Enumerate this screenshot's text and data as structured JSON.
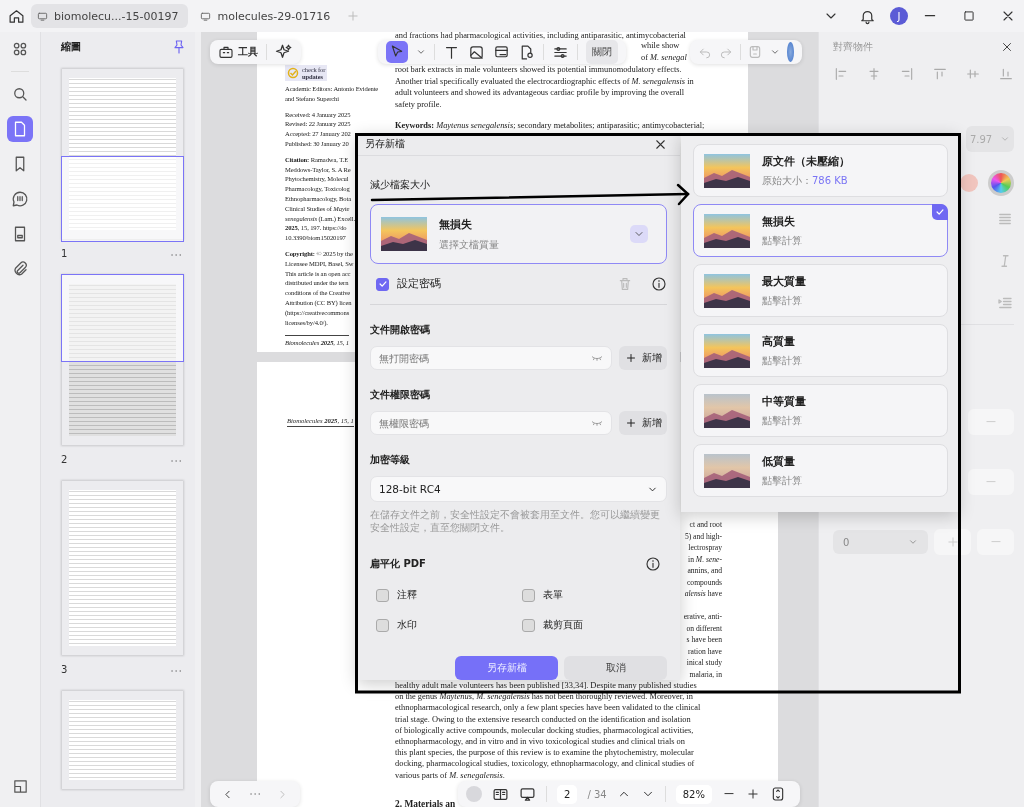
{
  "tabs": [
    {
      "label": "biomolecu...-15-00197",
      "selected": true
    },
    {
      "label": "molecules-29-01716",
      "selected": false
    }
  ],
  "user_avatar": "J",
  "rail": [
    {
      "kind": "grid",
      "selected": false
    },
    {
      "kind": "search",
      "selected": false
    },
    {
      "kind": "page",
      "selected": true
    },
    {
      "kind": "bookmark",
      "selected": false
    },
    {
      "kind": "comment",
      "selected": false
    },
    {
      "kind": "form",
      "selected": false
    },
    {
      "kind": "attachment",
      "selected": false
    }
  ],
  "thumbnails": {
    "title": "縮圖",
    "pages": [
      {
        "number": "1",
        "selected": false
      },
      {
        "number": "2",
        "selected": true
      },
      {
        "number": "3",
        "selected": false
      }
    ]
  },
  "toolbar": {
    "tools_label": "工具",
    "close_label": "關閉"
  },
  "page1": {
    "badge": [
      "check for",
      "updates"
    ],
    "left": [
      {
        "lines": [
          "Academic Editors: Antonio Evidente",
          "and Stefano Superchi"
        ]
      },
      {
        "lines": [
          "Received: 4 January 2025",
          "Revised: 22 January 2025",
          "Accepted: 27 January 202",
          "Published: 30 January 20"
        ]
      },
      {
        "lines": [
          "**Citation:** Ramadwa, T.E",
          "Meddows-Taylor, S. A Re",
          "Phytochemistry, Molecul",
          "Pharmacology, Toxicolog",
          "Ethnopharmacology, Bota",
          "Clinical Studies of *Mayte*",
          "*senegalensis* (Lam.) Excell.",
          "**2025**, 15, 197. https://do",
          "10.3390/biom15020197"
        ]
      },
      {
        "lines": [
          "**Copyright:** © 2025 by the",
          "Licensee MDPI, Basel, Sw",
          "This article is an open acc",
          "distributed under the tern",
          "conditions of the Creative",
          "Attribution (CC BY) licen",
          "(https://creativecommons",
          "licenses/by/4.0/)."
        ]
      }
    ],
    "footer": "*Biomolecules* **2025**, *15*, 1",
    "top_line": "and fractions had pharmacological activities, including antiparasitic, antimycobacterial",
    "gap_lines": [
      "while show",
      "of *M. senegal*"
    ],
    "paragraphs": [
      {
        "lines": [
          "root bark extracts in male volunteers showed its potential immunomodulatory effects.",
          "Another trial specifically evaluated the electrocardiographic effects of *M. senegalensis* in",
          "adult volunteers and showed its advantageous cardiac profile by improving the overall",
          "safety profile."
        ]
      },
      {
        "lines": [
          "**Keywords:** *Maytenus senegalensis*; secondary metabolites; antiparasitic; antimycobacterial;"
        ]
      }
    ]
  },
  "page2": {
    "header": "*Biomolecules* **2025**, *15*, 1",
    "fragments": [
      [
        "ct and root",
        "5) and high-",
        "lectrospray",
        "in *M. sene-*",
        "annins, and",
        "compounds",
        "*alensis* have"
      ],
      [
        "erative, anti-",
        "on different",
        "s have been",
        "ration have",
        "inical study",
        "malaria, in"
      ]
    ],
    "paragraph": [
      "healthy adult male volunteers has been published [33,34]. Despite many published studies",
      "on the genus *Maytenus*, *M. senegalensis* has not been thoroughly reviewed. Moreover, in",
      "ethnopharmacological research, only a few plant species have been validated to the clinical",
      "trial stage. Owing to the extensive research conducted on the identification and isolation",
      "of biologically active compounds, molecular docking studies, pharmacological activities,",
      "ethnopharmacology, and in vitro and in vivo toxicological studies and clinical trials on",
      "this plant species, the purpose of this review is to examine the phytochemistry, molecular",
      "docking, pharmacological studies, toxicology, ethnopharmacology, and clinical studies of",
      "various parts of *M. senegalensis*."
    ],
    "heading": "2. Materials an"
  },
  "pager": {
    "page": "2",
    "total": "/ 34",
    "zoom": "82%"
  },
  "right_panel": {
    "title": "對齊物件",
    "font_size": "7.97",
    "swatches": [
      {
        "color": "#f1c5be"
      }
    ],
    "spacing": "0"
  },
  "save_dialog": {
    "title": "另存新檔",
    "section": "減少檔案大小",
    "quality": {
      "name": "無損失",
      "hint": "選擇文檔質量"
    },
    "password": {
      "label": "設定密碼",
      "checked": true
    },
    "fields": [
      {
        "label": "文件開啟密碼",
        "placeholder": "無打開密碼",
        "add": "新增"
      },
      {
        "label": "文件權限密碼",
        "placeholder": "無權限密碼",
        "add": "新增"
      }
    ],
    "encryption": {
      "label": "加密等級",
      "value": "128-bit RC4"
    },
    "note": "在儲存文件之前，安全性設定不會被套用至文件。您可以繼續變更安全性設定，直至您關閉文件。",
    "flatten": {
      "label": "扁平化 PDF",
      "options": [
        {
          "label": "注釋",
          "checked": false
        },
        {
          "label": "表單",
          "checked": false
        },
        {
          "label": "水印",
          "checked": false
        },
        {
          "label": "裁剪頁面",
          "checked": false
        }
      ]
    },
    "save": "另存新檔",
    "cancel": "取消"
  },
  "quality_menu": [
    {
      "name": "原文件（未壓縮）",
      "detail": "原始大小：",
      "size": "786 KB",
      "selected": false
    },
    {
      "name": "無損失",
      "detail": "點擊計算",
      "selected": true
    },
    {
      "name": "最大質量",
      "detail": "點擊計算",
      "selected": false
    },
    {
      "name": "高質量",
      "detail": "點擊計算",
      "selected": false
    },
    {
      "name": "中等質量",
      "detail": "點擊計算",
      "selected": false
    },
    {
      "name": "低質量",
      "detail": "點擊計算",
      "selected": false
    }
  ]
}
